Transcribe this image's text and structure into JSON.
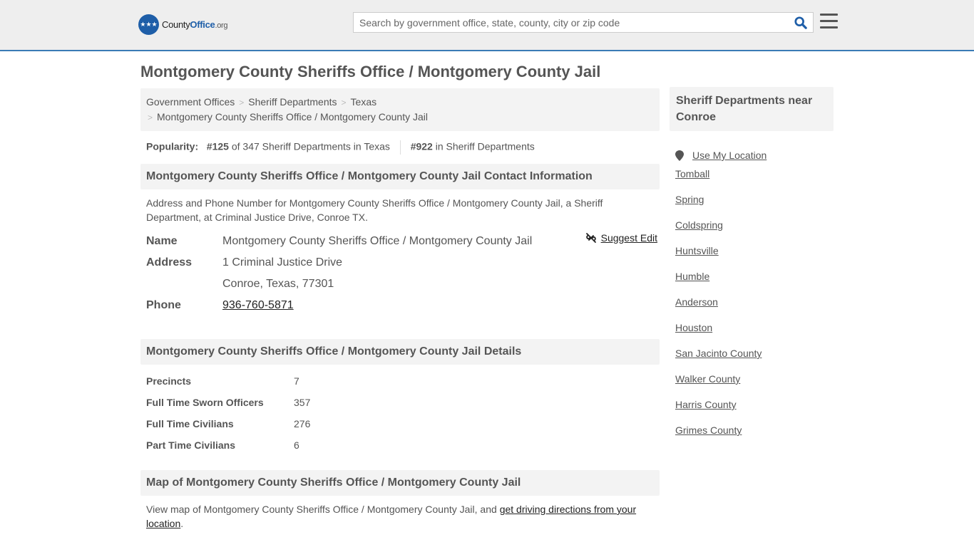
{
  "header": {
    "logo_text_main": "County",
    "logo_text_brand": "Office",
    "logo_text_tld": ".org",
    "search_placeholder": "Search by government office, state, county, city or zip code"
  },
  "page_title": "Montgomery County Sheriffs Office / Montgomery County Jail",
  "breadcrumb": [
    "Government Offices",
    "Sheriff Departments",
    "Texas",
    "Montgomery County Sheriffs Office / Montgomery County Jail"
  ],
  "popularity": {
    "label": "Popularity:",
    "state_rank": "#125",
    "state_text": "of 347 Sheriff Departments in Texas",
    "national_rank": "#922",
    "national_text": "in Sheriff Departments"
  },
  "contact": {
    "heading": "Montgomery County Sheriffs Office / Montgomery County Jail Contact Information",
    "description": "Address and Phone Number for Montgomery County Sheriffs Office / Montgomery County Jail, a Sheriff Department, at Criminal Justice Drive, Conroe TX.",
    "suggest_edit": "Suggest Edit",
    "name_label": "Name",
    "name_value": "Montgomery County Sheriffs Office / Montgomery County Jail",
    "address_label": "Address",
    "address_line1": "1 Criminal Justice Drive",
    "address_line2": "Conroe, Texas, 77301",
    "phone_label": "Phone",
    "phone_value": "936-760-5871"
  },
  "details": {
    "heading": "Montgomery County Sheriffs Office / Montgomery County Jail Details",
    "rows": [
      {
        "label": "Precincts",
        "value": "7"
      },
      {
        "label": "Full Time Sworn Officers",
        "value": "357"
      },
      {
        "label": "Full Time Civilians",
        "value": "276"
      },
      {
        "label": "Part Time Civilians",
        "value": "6"
      }
    ]
  },
  "map": {
    "heading": "Map of Montgomery County Sheriffs Office / Montgomery County Jail",
    "text": "View map of Montgomery County Sheriffs Office / Montgomery County Jail, and ",
    "link": "get driving directions from your location",
    "end": "."
  },
  "sidebar": {
    "heading": "Sheriff Departments near Conroe",
    "use_location": "Use My Location",
    "items": [
      "Tomball",
      "Spring",
      "Coldspring",
      "Huntsville",
      "Humble",
      "Anderson",
      "Houston",
      "San Jacinto County",
      "Walker County",
      "Harris County",
      "Grimes County"
    ]
  }
}
